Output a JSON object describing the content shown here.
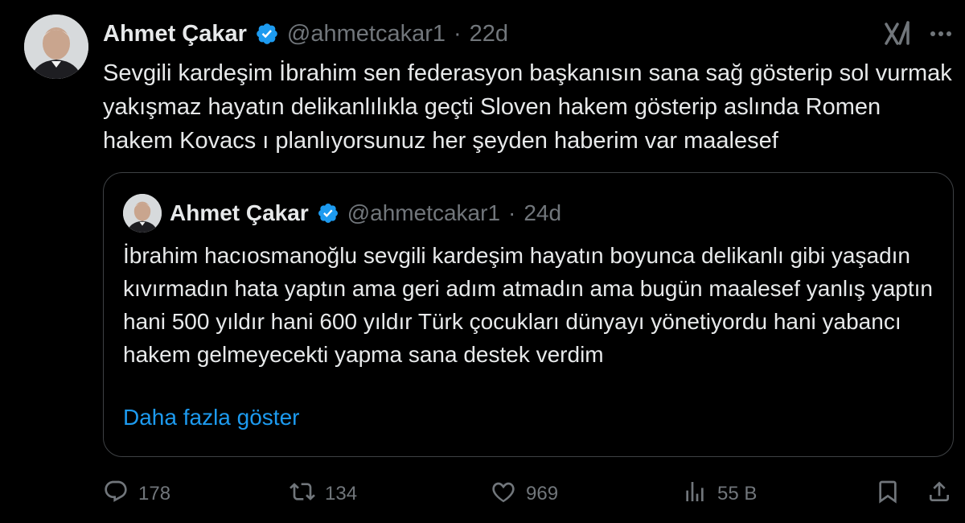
{
  "tweet": {
    "author_name": "Ahmet Çakar",
    "handle": "@ahmetcakar1",
    "separator": "·",
    "time": "22d",
    "text": "Sevgili kardeşim İbrahim sen federasyon başkanısın sana sağ gösterip sol vurmak yakışmaz hayatın delikanlılıkla geçti Sloven hakem gösterip aslında Romen hakem Kovacs ı planlıyorsunuz her şeyden haberim var maalesef"
  },
  "quote": {
    "author_name": "Ahmet Çakar",
    "handle": "@ahmetcakar1",
    "separator": "·",
    "time": "24d",
    "text": "İbrahim hacıosmanoğlu sevgili kardeşim hayatın boyunca delikanlı gibi yaşadın kıvırmadın hata yaptın ama geri adım atmadın ama bugün maalesef yanlış yaptın hani 500 yıldır hani 600 yıldır Türk çocukları dünyayı yönetiyordu hani yabancı hakem gelmeyecekti yapma sana destek verdim",
    "show_more": "Daha fazla göster"
  },
  "actions": {
    "replies": "178",
    "retweets": "134",
    "likes": "969",
    "views": "55 B"
  },
  "icons": {
    "verified": "verified-badge-icon",
    "grok": "grok-icon",
    "more": "more-icon",
    "reply": "reply-icon",
    "retweet": "retweet-icon",
    "like": "like-icon",
    "views": "views-icon",
    "bookmark": "bookmark-icon",
    "share": "share-icon"
  },
  "colors": {
    "background": "#000000",
    "text": "#e7e9ea",
    "muted": "#71767b",
    "link": "#1d9bf0",
    "verified": "#1d9bf0"
  }
}
